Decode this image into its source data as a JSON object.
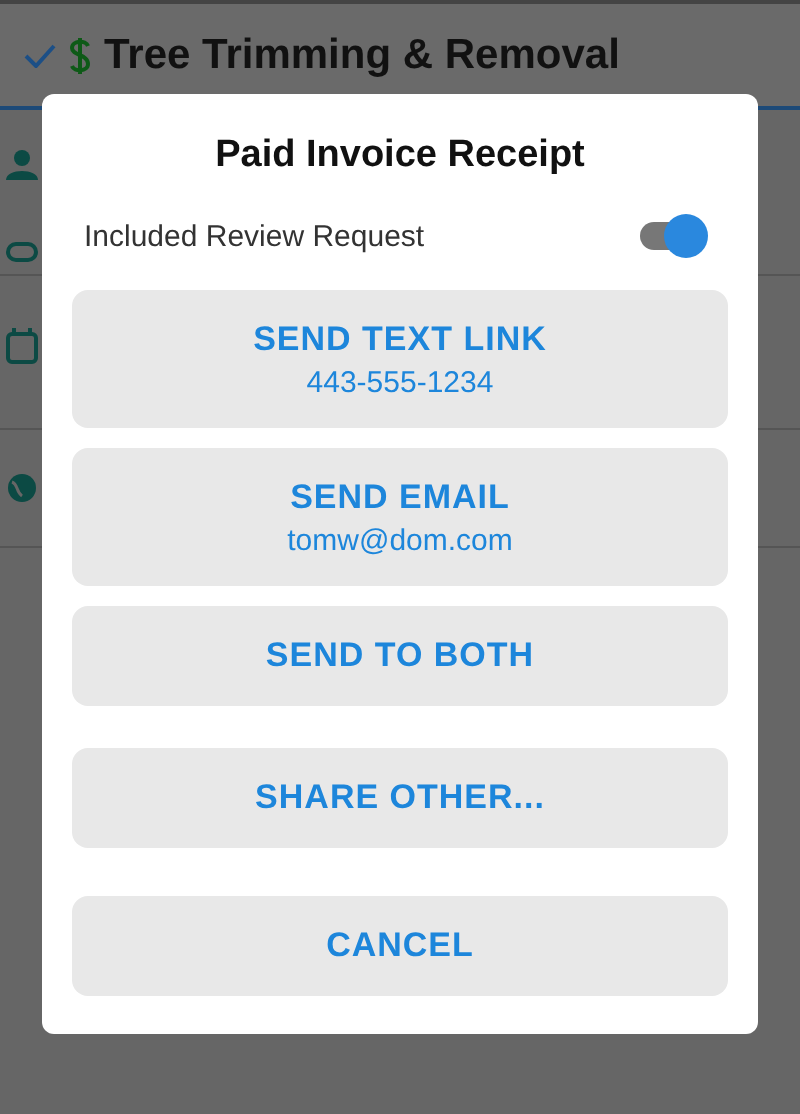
{
  "header": {
    "title": "Tree Trimming & Removal",
    "done": true
  },
  "dialog": {
    "title": "Paid Invoice Receipt",
    "toggle": {
      "label": "Included Review Request",
      "on": true
    },
    "buttons": [
      {
        "label": "SEND TEXT LINK",
        "detail": "443-555-1234"
      },
      {
        "label": "SEND EMAIL",
        "detail": "tomw@dom.com"
      },
      {
        "label": "SEND TO BOTH"
      },
      {
        "label": "SHARE OTHER..."
      },
      {
        "label": "CANCEL"
      }
    ]
  }
}
